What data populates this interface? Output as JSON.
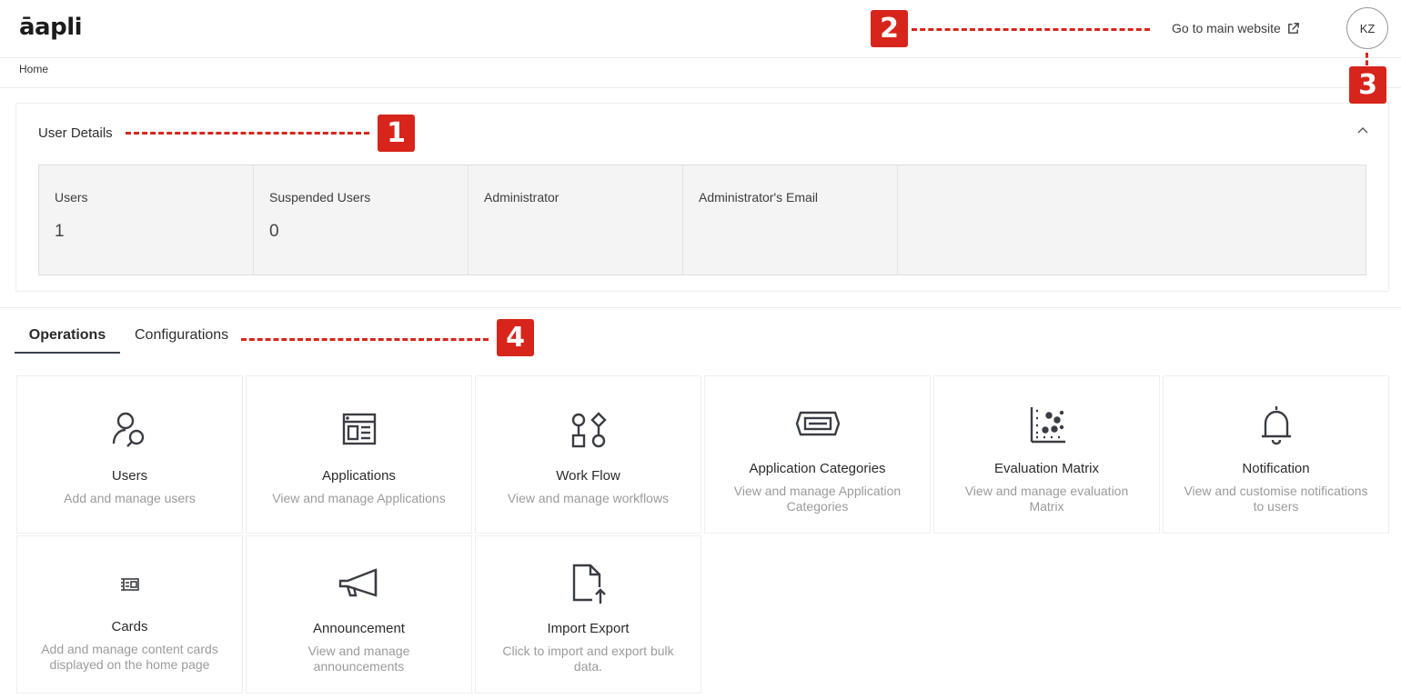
{
  "header": {
    "logo": "āapli",
    "main_link": "Go to main website",
    "avatar_initials": "KZ"
  },
  "breadcrumb": {
    "current": "Home"
  },
  "user_details": {
    "title": "User Details",
    "stats": [
      {
        "label": "Users",
        "value": "1"
      },
      {
        "label": "Suspended Users",
        "value": "0"
      },
      {
        "label": "Administrator",
        "value": ""
      },
      {
        "label": "Administrator's Email",
        "value": ""
      }
    ]
  },
  "tabs": [
    {
      "label": "Operations",
      "active": true
    },
    {
      "label": "Configurations",
      "active": false
    }
  ],
  "tiles": [
    {
      "title": "Users",
      "subtitle": "Add and manage users",
      "icon": "users-icon"
    },
    {
      "title": "Applications",
      "subtitle": "View and manage Applications",
      "icon": "applications-icon"
    },
    {
      "title": "Work Flow",
      "subtitle": "View and manage workflows",
      "icon": "workflow-icon"
    },
    {
      "title": "Application Categories",
      "subtitle": "View and manage Application Categories",
      "icon": "categories-icon"
    },
    {
      "title": "Evaluation Matrix",
      "subtitle": "View and manage evaluation Matrix",
      "icon": "matrix-icon"
    },
    {
      "title": "Notification",
      "subtitle": "View and customise notifications to users",
      "icon": "bell-icon"
    },
    {
      "title": "Cards",
      "subtitle": "Add and manage content cards displayed on the home page",
      "icon": "cards-icon"
    },
    {
      "title": "Announcement",
      "subtitle": "View and manage announcements",
      "icon": "megaphone-icon"
    },
    {
      "title": "Import Export",
      "subtitle": "Click to import and export bulk data.",
      "icon": "file-upload-icon"
    }
  ],
  "annotations": [
    "1",
    "2",
    "3",
    "4"
  ],
  "colors": {
    "annotation": "#d7251b",
    "tab_underline": "#3a4150",
    "muted_text": "#9b9b9b"
  }
}
